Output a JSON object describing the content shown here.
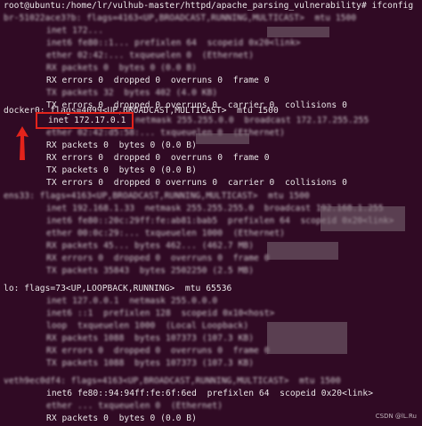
{
  "terminal": {
    "prompt": "root@ubuntu:/home/lr/vulhub-master/httpd/apache_parsing_vulnerability# ifconfig",
    "br": {
      "header": "br-51022ace3?b: flags=4163<UP,BROADCAST,RUNNING,MULTICAST>  mtu 1500",
      "inet": "inet 172...",
      "inet6": "inet6 fe80::1... prefixlen 64  scopeid 0x20<link>",
      "ether": "ether 02:42:... txqueuelen 0  (Ethernet)",
      "rx_packets": "RX packets 0  bytes 0 (0.0 B)",
      "rx_errors": "RX errors 0  dropped 0  overruns 0  frame 0",
      "tx_packets": "TX packets 32  bytes 402 (4.0 KB)",
      "tx_errors": "TX errors 0  dropped 0 overruns 0  carrier 0  collisions 0"
    },
    "docker": {
      "header": "docker0: flags=4099<UP,BROADCAST,MULTICAST>  mtu 1500",
      "inet": "inet 172.17.0.1",
      "inet_rest": "netmask 255.255.0.0  broadcast 172.17.255.255",
      "ether": "ether 02:42:d5:58:... txqueuelen 0  (Ethernet)",
      "rx_packets": "RX packets 0  bytes 0 (0.0 B)",
      "rx_errors": "RX errors 0  dropped 0  overruns 0  frame 0",
      "tx_packets": "TX packets 0  bytes 0 (0.0 B)",
      "tx_errors": "TX errors 0  dropped 0 overruns 0  carrier 0  collisions 0"
    },
    "ens": {
      "header": "ens33: flags=4163<UP,BROADCAST,RUNNING,MULTICAST>  mtu 1500",
      "inet": "inet 192.168.1.33  netmask 255.255.255.0  broadcast 192.168.1.255",
      "inet6": "inet6 fe80::20c:29ff:fe:ab81:bab5  prefixlen 64  scopeid 0x20<link>",
      "ether": "ether 00:0c:29:... txqueuelen 1000  (Ethernet)",
      "rx_packets": "RX packets 45... bytes 462... (462.7 MB)",
      "rx_errors": "RX errors 0  dropped 0  overruns 0  frame 0",
      "tx_packets": "TX packets 35843  bytes 2502250 (2.5 MB)",
      "tx_errors": "TX errors 0  dropped 0 overruns 0  carrier 0  collisions 0"
    },
    "lo": {
      "header": "lo: flags=73<UP,LOOPBACK,RUNNING>  mtu 65536",
      "inet": "inet 127.0.0.1  netmask 255.0.0.0",
      "inet6": "inet6 ::1  prefixlen 128  scopeid 0x10<host>",
      "loop": "loop  txqueuelen 1000  (Local Loopback)",
      "rx_packets": "RX packets 1088  bytes 107373 (107.3 KB)",
      "rx_errors": "RX errors 0  dropped 0  overruns 0  frame 0",
      "tx_packets": "TX packets 1088  bytes 107373 (107.3 KB)",
      "tx_errors": "TX errors 0  dropped 0 overruns 0  carrier 0  collisions 0"
    },
    "veth": {
      "header": "veth9ec0df4: flags=4163<UP,BROADCAST,RUNNING,MULTICAST>  mtu 1500",
      "inet6": "inet6 fe80::94:94ff:fe:6f:6ed  prefixlen 64  scopeid 0x20<link>",
      "ether": "ether ... txqueuelen 0  (Ethernet)",
      "rx_packets": "RX packets 0  bytes 0 (0.0 B)"
    },
    "watermark": "CSDN @lL.Ru"
  },
  "colors": {
    "background": "#300a24",
    "text": "#e8e4e6",
    "highlight": "#e3231b"
  }
}
